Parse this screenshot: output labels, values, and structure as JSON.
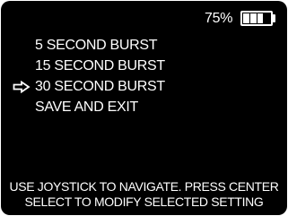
{
  "status": {
    "battery_percent": "75%",
    "battery_level": 0.75,
    "battery_icon": "battery-icon"
  },
  "menu": {
    "items": [
      {
        "label": "5 SECOND BURST",
        "selected": false
      },
      {
        "label": "15 SECOND BURST",
        "selected": false
      },
      {
        "label": "30 SECOND BURST",
        "selected": true
      },
      {
        "label": "SAVE AND EXIT",
        "selected": false
      }
    ],
    "selection_icon": "arrow-right-icon"
  },
  "footer": {
    "line1": "USE JOYSTICK TO NAVIGATE. PRESS CENTER",
    "line2": "SELECT TO MODIFY SELECTED SETTING"
  },
  "colors": {
    "background": "#000000",
    "foreground": "#ffffff"
  }
}
